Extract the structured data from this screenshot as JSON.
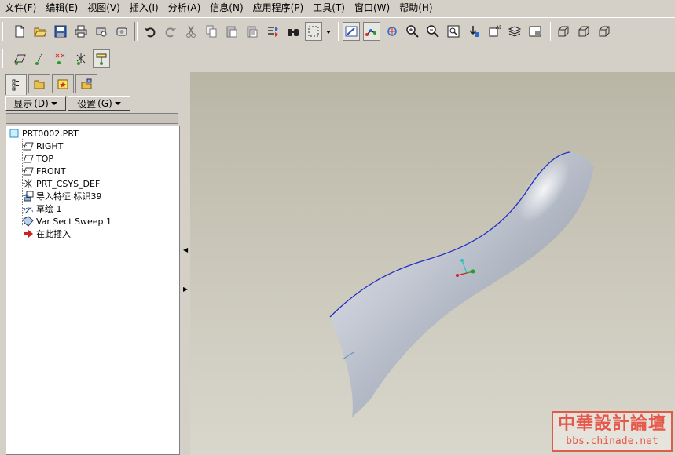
{
  "menu": [
    {
      "label": "文件(F)"
    },
    {
      "label": "编辑(E)"
    },
    {
      "label": "视图(V)"
    },
    {
      "label": "插入(I)"
    },
    {
      "label": "分析(A)"
    },
    {
      "label": "信息(N)"
    },
    {
      "label": "应用程序(P)"
    },
    {
      "label": "工具(T)"
    },
    {
      "label": "窗口(W)"
    },
    {
      "label": "帮助(H)"
    }
  ],
  "toolbar_icons": [
    "new-icon",
    "open-icon",
    "save-icon",
    "print-icon",
    "print-preview-icon",
    "send-icon",
    "undo-icon",
    "redo-icon",
    "cut-icon",
    "copy-icon",
    "paste-icon",
    "paste-special-icon",
    "regenerate-icon",
    "find-icon",
    "selection-filter-icon",
    "repaint-icon",
    "datum-display-icon",
    "spin-center-icon",
    "zoom-in-icon",
    "zoom-out-icon",
    "refit-icon",
    "reorient-icon",
    "named-view-icon",
    "layers-icon",
    "view-manager-icon",
    "wireframe-icon",
    "hidden-line-icon",
    "no-hidden-icon"
  ],
  "datum_toolbar_icons": [
    "datum-plane-display-icon",
    "datum-axis-display-icon",
    "datum-point-display-icon",
    "csys-display-icon",
    "annotation-display-icon"
  ],
  "panel": {
    "tabs": [
      "model-tree-tab",
      "folder-browser-tab",
      "favorites-tab",
      "connections-tab"
    ],
    "show_menu": "显示",
    "show_key": "(D)",
    "settings_menu": "设置",
    "settings_key": "(G)"
  },
  "tree": {
    "root": "PRT0002.PRT",
    "items": [
      {
        "label": "RIGHT",
        "icon": "datum-plane-icon"
      },
      {
        "label": "TOP",
        "icon": "datum-plane-icon"
      },
      {
        "label": "FRONT",
        "icon": "datum-plane-icon"
      },
      {
        "label": "PRT_CSYS_DEF",
        "icon": "coordinate-system-icon"
      },
      {
        "label": "导入特征 标识39",
        "icon": "import-feature-icon"
      },
      {
        "label": "草绘 1",
        "icon": "sketch-icon"
      },
      {
        "label": "Var Sect Sweep 1",
        "icon": "sweep-icon"
      },
      {
        "label": "在此插入",
        "icon": "insert-here-arrow-icon"
      }
    ]
  },
  "watermark": {
    "title": "中華設計論壇",
    "url": "bbs.chinade.net"
  },
  "colors": {
    "background": "#d4d0c8",
    "viewport_top": "#b9b6a6",
    "viewport_bottom": "#d9d7cc",
    "surface": "#a9b0bb",
    "edge": "#2030c0",
    "watermark": "#e7584a"
  }
}
